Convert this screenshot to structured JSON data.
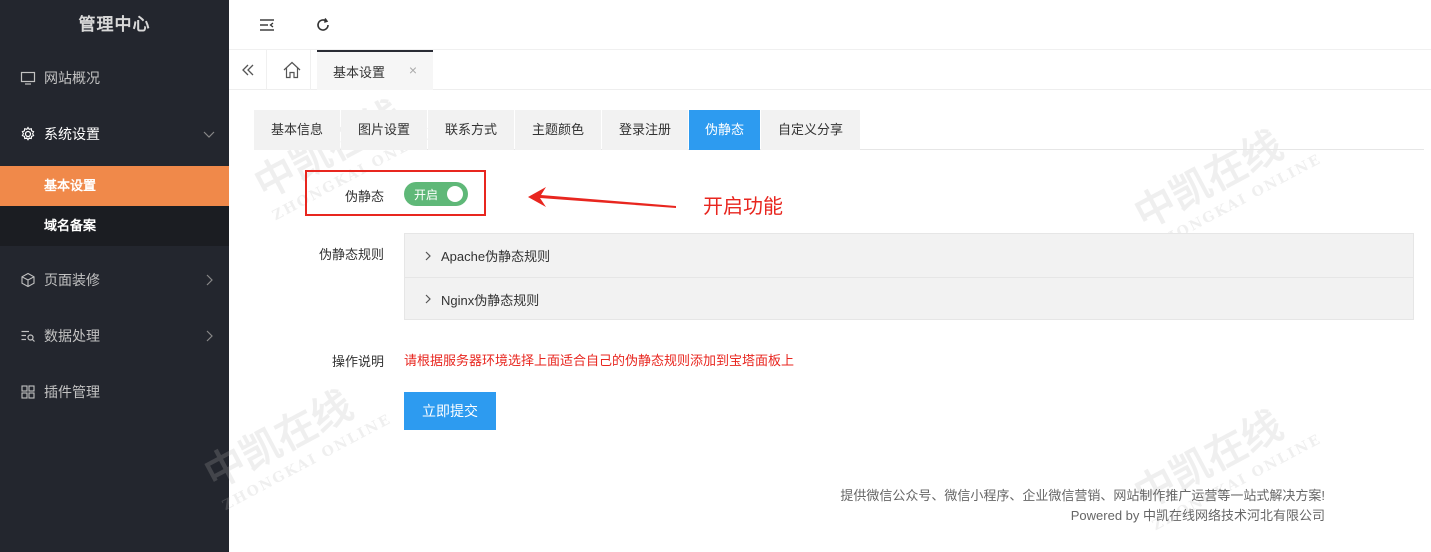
{
  "brand": "管理中心",
  "sidebar": {
    "items": [
      {
        "label": "网站概况",
        "icon": "monitor-icon"
      },
      {
        "label": "系统设置",
        "icon": "gear-icon"
      },
      {
        "label": "页面装修",
        "icon": "cube-icon"
      },
      {
        "label": "数据处理",
        "icon": "list-search-icon"
      },
      {
        "label": "插件管理",
        "icon": "grid-icon"
      }
    ],
    "sub_items": [
      {
        "label": "基本设置"
      },
      {
        "label": "域名备案"
      }
    ]
  },
  "page_tab": {
    "label": "基本设置",
    "close": "×"
  },
  "tabs": [
    "基本信息",
    "图片设置",
    "联系方式",
    "主题颜色",
    "登录注册",
    "伪静态",
    "自定义分享"
  ],
  "form": {
    "pseudo_label": "伪静态",
    "switch_text": "开启",
    "rules_label": "伪静态规则",
    "rules": [
      "Apache伪静态规则",
      "Nginx伪静态规则"
    ],
    "note_label": "操作说明",
    "note_text": "请根据服务器环境选择上面适合自己的伪静态规则添加到宝塔面板上",
    "submit": "立即提交"
  },
  "annotation": "开启功能",
  "footer": {
    "line1": "提供微信公众号、微信小程序、企业微信营销、网站制作推广运营等一站式解决方案!",
    "line2": "Powered by 中凯在线网络技术河北有限公司"
  },
  "watermark": {
    "cn": "中凯在线",
    "en": "ZHONGKAI ONLINE"
  },
  "colors": {
    "sidebar_bg": "#23262e",
    "accent_orange": "#f0894a",
    "primary_blue": "#2d9bf0",
    "switch_green": "#5fb878",
    "alert_red": "#e8261f"
  }
}
